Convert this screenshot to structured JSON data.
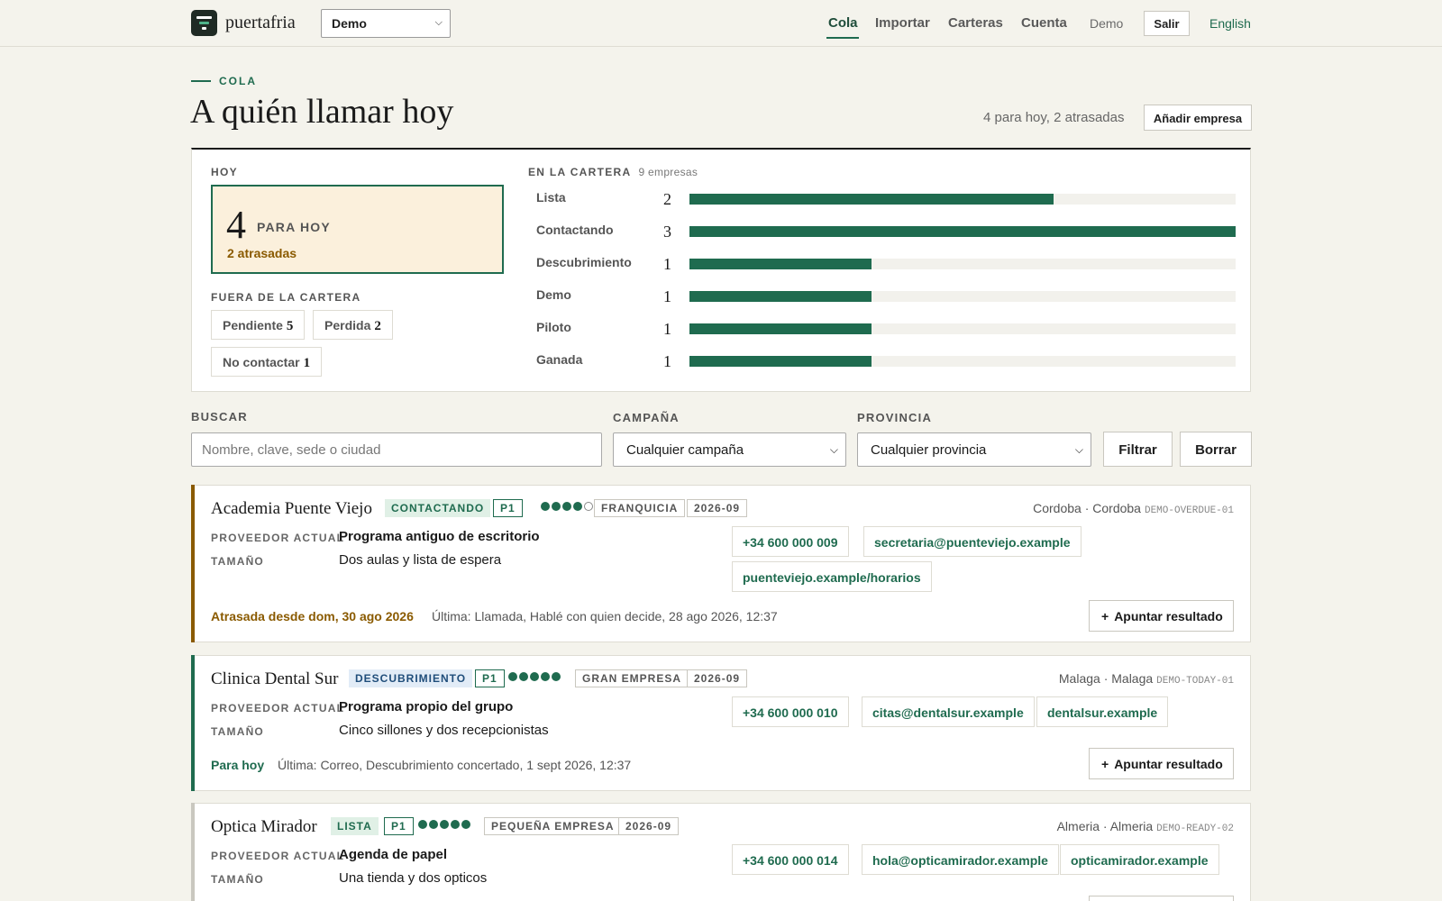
{
  "nav": {
    "brand": "puertafria",
    "org_select": "Demo",
    "items": [
      "Cola",
      "Importar",
      "Carteras",
      "Cuenta"
    ],
    "user": "Demo",
    "logout": "Salir",
    "language": "English"
  },
  "header": {
    "eyebrow": "COLA",
    "title": "A quién llamar hoy",
    "summary": "4 para hoy, 2 atrasadas",
    "add_button": "Añadir empresa"
  },
  "stats": {
    "today_label": "HOY",
    "today_count": "4",
    "today_count_label": "PARA HOY",
    "overdue_text": "2 atrasadas",
    "outside_label": "FUERA DE LA CARTERA",
    "outside": [
      {
        "label": "Pendiente",
        "count": "5"
      },
      {
        "label": "Perdida",
        "count": "2"
      },
      {
        "label": "No contactar",
        "count": "1"
      }
    ],
    "pipeline_label": "EN LA CARTERA",
    "pipeline_count": "9 empresas",
    "pipeline": [
      {
        "stage": "Lista",
        "count": "2",
        "fraction": 0.667
      },
      {
        "stage": "Contactando",
        "count": "3",
        "fraction": 1.0
      },
      {
        "stage": "Descubrimiento",
        "count": "1",
        "fraction": 0.333
      },
      {
        "stage": "Demo",
        "count": "1",
        "fraction": 0.333
      },
      {
        "stage": "Piloto",
        "count": "1",
        "fraction": 0.333
      },
      {
        "stage": "Ganada",
        "count": "1",
        "fraction": 0.333
      }
    ]
  },
  "filters": {
    "search_label": "BUSCAR",
    "search_placeholder": "Nombre, clave, sede o ciudad",
    "campaign_label": "CAMPAÑA",
    "campaign_value": "Cualquier campaña",
    "province_label": "PROVINCIA",
    "province_value": "Cualquier provincia",
    "filter_button": "Filtrar",
    "clear_button": "Borrar"
  },
  "labels": {
    "provider": "PROVEEDOR ACTUAL",
    "size": "TAMAÑO",
    "result_button": "Apuntar resultado",
    "result_plus": "+"
  },
  "colors": {
    "accent_green": "#1f6b4f",
    "accent_overdue": "#8a5a00",
    "accent_ready": "#c9c7bf"
  },
  "cards": [
    {
      "name": "Academia Puente Viejo",
      "stage": "CONTACTANDO",
      "priority": "P1",
      "score": 4,
      "segment": "FRANQUICIA",
      "period": "2026-09",
      "location": "Cordoba · Cordoba",
      "key": "DEMO-OVERDUE-01",
      "provider": "Programa antiguo de escritorio",
      "size": "Dos aulas y lista de espera",
      "contacts": [
        "+34 600 000 009",
        "secretaria@puenteviejo.example",
        "puenteviejo.example/horarios"
      ],
      "due": "Atrasada desde dom, 30 ago 2026",
      "last": "Última: Llamada, Hablé con quien decide, 28 ago 2026, 12:37"
    },
    {
      "name": "Clinica Dental Sur",
      "stage": "DESCUBRIMIENTO",
      "priority": "P1",
      "score": 5,
      "segment": "GRAN EMPRESA",
      "period": "2026-09",
      "location": "Malaga · Malaga",
      "key": "DEMO-TODAY-01",
      "provider": "Programa propio del grupo",
      "size": "Cinco sillones y dos recepcionistas",
      "contacts": [
        "+34 600 000 010",
        "citas@dentalsur.example",
        "dentalsur.example"
      ],
      "due": "Para hoy",
      "last": "Última: Correo, Descubrimiento concertado, 1 sept 2026, 12:37"
    },
    {
      "name": "Optica Mirador",
      "stage": "LISTA",
      "priority": "P1",
      "score": 5,
      "segment": "PEQUEÑA EMPRESA",
      "period": "2026-09",
      "location": "Almeria · Almeria",
      "key": "DEMO-READY-02",
      "provider": "Agenda de papel",
      "size": "Una tienda y dos opticos",
      "contacts": [
        "+34 600 000 014",
        "hola@opticamirador.example",
        "opticamirador.example"
      ]
    }
  ]
}
